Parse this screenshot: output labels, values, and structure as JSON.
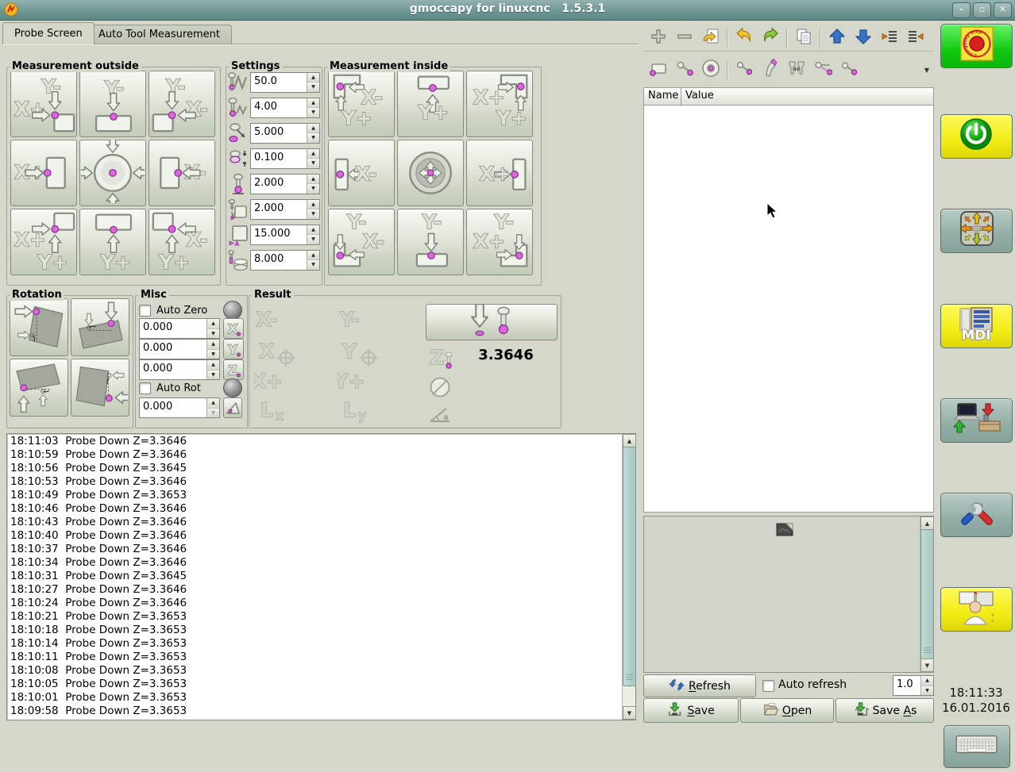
{
  "window": {
    "title": "gmoccapy for linuxcnc   1.5.3.1",
    "icon": "gmoccapy-logo-icon",
    "controls": [
      {
        "name": "minimize-button",
        "glyph": "minus"
      },
      {
        "name": "maximize-button",
        "glyph": "square"
      },
      {
        "name": "close-button",
        "glyph": "x"
      }
    ]
  },
  "tabs": [
    {
      "label": "Probe Screen",
      "active": true
    },
    {
      "label": "Auto Tool Measurement",
      "active": false
    }
  ],
  "outside": {
    "title": "Measurement outside",
    "buttons": [
      {
        "name": "probe-outside-corner-ym-xp",
        "icon": "out-corner-ym-xp",
        "labels": [
          "Y-",
          "X+"
        ]
      },
      {
        "name": "probe-outside-edge-ym",
        "icon": "out-edge-ym",
        "labels": [
          "Y-"
        ]
      },
      {
        "name": "probe-outside-corner-ym-xm",
        "icon": "out-corner-ym-xm",
        "labels": [
          "Y-",
          "X-"
        ]
      },
      {
        "name": "probe-outside-edge-xp",
        "icon": "out-edge-xp",
        "labels": [
          "X+"
        ]
      },
      {
        "name": "probe-outside-center",
        "icon": "out-center",
        "labels": []
      },
      {
        "name": "probe-outside-edge-xm",
        "icon": "out-edge-xm",
        "labels": [
          "X-"
        ]
      },
      {
        "name": "probe-outside-corner-yp-xp",
        "icon": "out-corner-yp-xp",
        "labels": [
          "X+",
          "Y+"
        ]
      },
      {
        "name": "probe-outside-edge-yp",
        "icon": "out-edge-yp",
        "labels": [
          "Y+"
        ]
      },
      {
        "name": "probe-outside-corner-yp-xm",
        "icon": "out-corner-yp-xm",
        "labels": [
          "X-",
          "Y+"
        ]
      }
    ]
  },
  "settings": {
    "title": "Settings",
    "rows": [
      {
        "icon": "search-velocity-icon",
        "value": "50.0"
      },
      {
        "icon": "probe-velocity-icon",
        "value": "4.00"
      },
      {
        "icon": "probe-max-icon",
        "value": "5.000"
      },
      {
        "icon": "probe-latch-icon",
        "value": "0.100"
      },
      {
        "icon": "probe-diameter-icon",
        "value": "2.000"
      },
      {
        "icon": "xy-clearance-icon",
        "value": "2.000"
      },
      {
        "icon": "edge-length-icon",
        "value": "15.000"
      },
      {
        "icon": "z-clearance-icon",
        "value": "8.000"
      }
    ]
  },
  "inside": {
    "title": "Measurement inside",
    "buttons": [
      {
        "name": "probe-inside-corner-xm-yp",
        "icon": "in-corner-xm-yp",
        "labels": [
          "X-",
          "Y+"
        ]
      },
      {
        "name": "probe-inside-edge-yp",
        "icon": "in-edge-yp",
        "labels": [
          "Y+"
        ]
      },
      {
        "name": "probe-inside-corner-xp-yp",
        "icon": "in-corner-xp-yp",
        "labels": [
          "X+",
          "Y+"
        ]
      },
      {
        "name": "probe-inside-edge-xm",
        "icon": "in-edge-xm",
        "labels": [
          "X-"
        ]
      },
      {
        "name": "probe-inside-hole-center",
        "icon": "in-center",
        "labels": []
      },
      {
        "name": "probe-inside-edge-xp",
        "icon": "in-edge-xp",
        "labels": [
          "X+"
        ]
      },
      {
        "name": "probe-inside-corner-ym-xm",
        "icon": "in-corner-ym-xm",
        "labels": [
          "Y-",
          "X-"
        ]
      },
      {
        "name": "probe-inside-edge-ym",
        "icon": "in-edge-ym",
        "labels": [
          "Y-"
        ]
      },
      {
        "name": "probe-inside-corner-ym-xp",
        "icon": "in-corner-ym-xp",
        "labels": [
          "Y-",
          "X+"
        ]
      }
    ]
  },
  "rotation": {
    "title": "Rotation",
    "buttons": [
      {
        "name": "angle-probe-x-left",
        "icon": "rot-x-left"
      },
      {
        "name": "angle-probe-y-top",
        "icon": "rot-y-top"
      },
      {
        "name": "angle-probe-y-bottom",
        "icon": "rot-y-bottom"
      },
      {
        "name": "angle-probe-x-right",
        "icon": "rot-x-right"
      }
    ]
  },
  "misc": {
    "title": "Misc",
    "auto_zero_label": "Auto Zero",
    "auto_rot_label": "Auto Rot",
    "fields": [
      {
        "value": "0.000",
        "axis": "X"
      },
      {
        "value": "0.000",
        "axis": "Y"
      },
      {
        "value": "0.000",
        "axis": "Z"
      }
    ],
    "angle_field": {
      "value": "0.000",
      "icon": "angle-set-icon"
    }
  },
  "result": {
    "title": "Result",
    "col1": [
      {
        "t": "X-",
        "sub": "",
        "cross": false
      },
      {
        "t": "X",
        "sub": "",
        "cross": true
      },
      {
        "t": "X+",
        "sub": "",
        "cross": false
      },
      {
        "t": "L",
        "sub": "x",
        "cross": false
      }
    ],
    "col2": [
      {
        "t": "Y-",
        "sub": "",
        "cross": false
      },
      {
        "t": "Y",
        "sub": "",
        "cross": true
      },
      {
        "t": "Y+",
        "sub": "",
        "cross": false
      },
      {
        "t": "L",
        "sub": "y",
        "cross": false
      }
    ],
    "z_label": "Z",
    "z_value": "3.3646",
    "angle_letter": "a",
    "probe_down_icon": "probe-down-icon",
    "diameter_icon": "diameter-icon",
    "angle_icon": "angle-icon"
  },
  "log": {
    "lines": [
      "18:11:03  Probe Down Z=3.3646",
      "18:10:59  Probe Down Z=3.3646",
      "18:10:56  Probe Down Z=3.3645",
      "18:10:53  Probe Down Z=3.3646",
      "18:10:49  Probe Down Z=3.3653",
      "18:10:46  Probe Down Z=3.3646",
      "18:10:43  Probe Down Z=3.3646",
      "18:10:40  Probe Down Z=3.3646",
      "18:10:37  Probe Down Z=3.3646",
      "18:10:34  Probe Down Z=3.3646",
      "18:10:31  Probe Down Z=3.3645",
      "18:10:27  Probe Down Z=3.3646",
      "18:10:24  Probe Down Z=3.3646",
      "18:10:21  Probe Down Z=3.3653",
      "18:10:18  Probe Down Z=3.3653",
      "18:10:14  Probe Down Z=3.3653",
      "18:10:11  Probe Down Z=3.3653",
      "18:10:08  Probe Down Z=3.3653",
      "18:10:05  Probe Down Z=3.3653",
      "18:10:01  Probe Down Z=3.3653",
      "18:09:58  Probe Down Z=3.3653"
    ]
  },
  "gcode_panel": {
    "toolbar1": [
      "add-icon",
      "remove-icon",
      "revert-icon",
      "sep",
      "undo-icon",
      "redo-icon",
      "sep",
      "copy-icon",
      "sep",
      "move-up-icon",
      "move-down-icon",
      "unindent-icon",
      "indent-icon"
    ],
    "toolbar2": [
      "rect-point-icon",
      "line-points-icon",
      "circle-point-icon",
      "sep",
      "line-segment-icon",
      "pen-icon",
      "toolchange-icon",
      "triangle-points-icon",
      "line-end-icon"
    ],
    "toolbar2_dropdown": "dropdown-caret-icon",
    "table": {
      "columns": [
        "Name",
        "Value"
      ]
    },
    "preview": {
      "icon": "broken-image-icon"
    },
    "refresh": {
      "label": "Refresh",
      "mnemonic": "R",
      "icon": "refresh-icon",
      "auto_label": "Auto refresh",
      "interval": "1.0"
    },
    "files": [
      {
        "label": "Save",
        "mnemonic": "S",
        "icon": "save-icon"
      },
      {
        "label": "Open",
        "mnemonic": "O",
        "icon": "open-icon"
      },
      {
        "label": "Save As",
        "mnemonic": "A",
        "icon": "save-as-icon"
      }
    ]
  },
  "right_strip": {
    "buttons": [
      {
        "name": "estop-button",
        "icon": "estop-icon",
        "bg": "green",
        "ring_text": "Emergency Stop"
      },
      {
        "name": "power-button",
        "icon": "power-icon",
        "bg": "yellow"
      },
      {
        "name": "jog-mode-button",
        "icon": "jog-pad-icon",
        "bg": "teal"
      },
      {
        "name": "mdi-mode-button",
        "icon": "mdi-icon",
        "bg": "yellow",
        "label": "MDI"
      },
      {
        "name": "auto-mode-button",
        "icon": "auto-mode-icon",
        "bg": "teal"
      },
      {
        "name": "settings-button",
        "icon": "tools-icon",
        "bg": "teal"
      },
      {
        "name": "user-mode-button",
        "icon": "user-icon",
        "bg": "yellow"
      }
    ],
    "clock": {
      "time": "18:11:33",
      "date": "16.01.2016"
    },
    "keyboard_button": {
      "name": "keyboard-button",
      "icon": "keyboard-icon",
      "bg": "teal"
    }
  }
}
